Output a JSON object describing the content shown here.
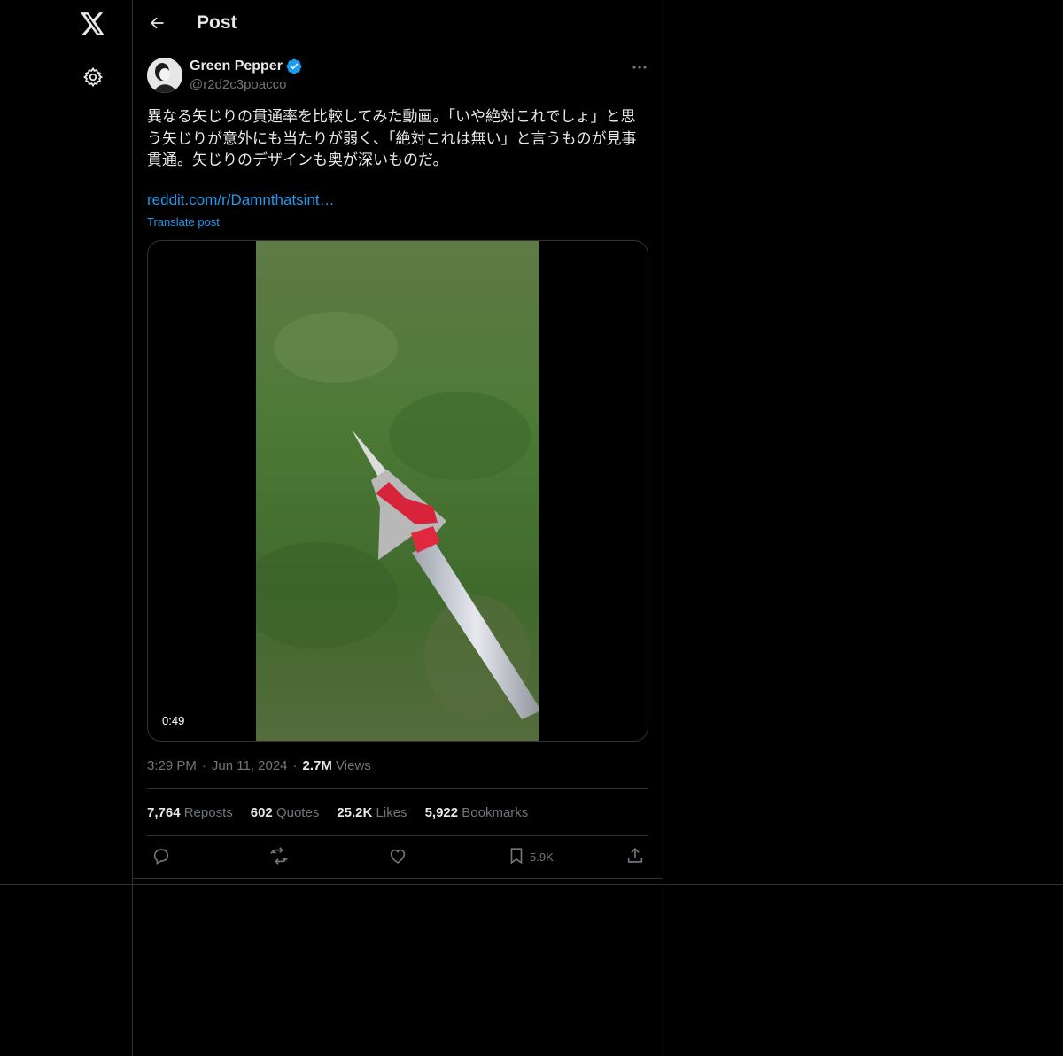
{
  "header": {
    "title": "Post"
  },
  "post": {
    "author_name": "Green Pepper",
    "author_handle": "@r2d2c3poacco",
    "text": "異なる矢じりの貫通率を比較してみた動画。「いや絶対これでしょ」と思う矢じりが意外にも当たりが弱く、「絶対これは無い」と言うものが見事貫通。矢じりのデザインも奥が深いものだ。",
    "link": "reddit.com/r/Damnthatsint…",
    "translate": "Translate post",
    "video_duration": "0:49",
    "time": "3:29 PM",
    "date": "Jun 11, 2024",
    "views_count": "2.7M",
    "views_label": "Views",
    "stats": {
      "reposts_count": "7,764",
      "reposts_label": "Reposts",
      "quotes_count": "602",
      "quotes_label": "Quotes",
      "likes_count": "25.2K",
      "likes_label": "Likes",
      "bookmarks_count": "5,922",
      "bookmarks_label": "Bookmarks"
    },
    "actions": {
      "bookmark_count": "5.9K"
    }
  },
  "icons": {
    "logo": "x-logo-icon",
    "settings": "gear-icon",
    "back": "back-arrow-icon",
    "verified": "verified-badge-icon",
    "more": "more-icon",
    "reply": "reply-icon",
    "repost": "repost-icon",
    "like": "heart-icon",
    "bookmark": "bookmark-icon",
    "share": "share-icon"
  },
  "colors": {
    "accent": "#1d9bf0",
    "background": "#000000",
    "muted": "#71767b",
    "border": "#2f3336"
  }
}
